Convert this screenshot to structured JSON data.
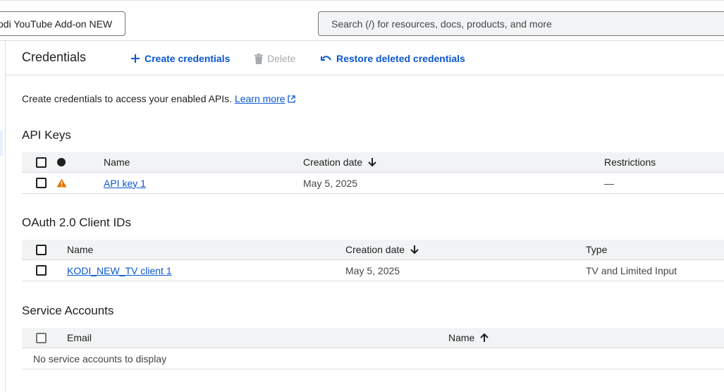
{
  "header": {
    "project_label": "odi YouTube Add-on NEW",
    "search_placeholder": "Search (/) for resources, docs, products, and more"
  },
  "toolbar": {
    "title": "Credentials",
    "create_label": "Create credentials",
    "delete_label": "Delete",
    "restore_label": "Restore deleted credentials"
  },
  "intro": {
    "text": "Create credentials to access your enabled APIs.",
    "learn_more": "Learn more"
  },
  "api_keys": {
    "title": "API Keys",
    "columns": {
      "name": "Name",
      "creation_date": "Creation date",
      "restrictions": "Restrictions"
    },
    "rows": [
      {
        "name": "API key 1",
        "creation_date": "May 5, 2025",
        "restrictions": "—",
        "status": "warning-icon"
      }
    ]
  },
  "oauth": {
    "title": "OAuth 2.0 Client IDs",
    "columns": {
      "name": "Name",
      "creation_date": "Creation date",
      "type": "Type"
    },
    "rows": [
      {
        "name": "KODI_NEW_TV client 1",
        "creation_date": "May 5, 2025",
        "type": "TV and Limited Input"
      }
    ]
  },
  "service_accounts": {
    "title": "Service Accounts",
    "columns": {
      "email": "Email",
      "name": "Name"
    },
    "empty_text": "No service accounts to display"
  },
  "colors": {
    "accent": "#0b57d0",
    "warning": "#e37400",
    "header_bg": "#f1f3f4",
    "divider": "#dadce0"
  }
}
